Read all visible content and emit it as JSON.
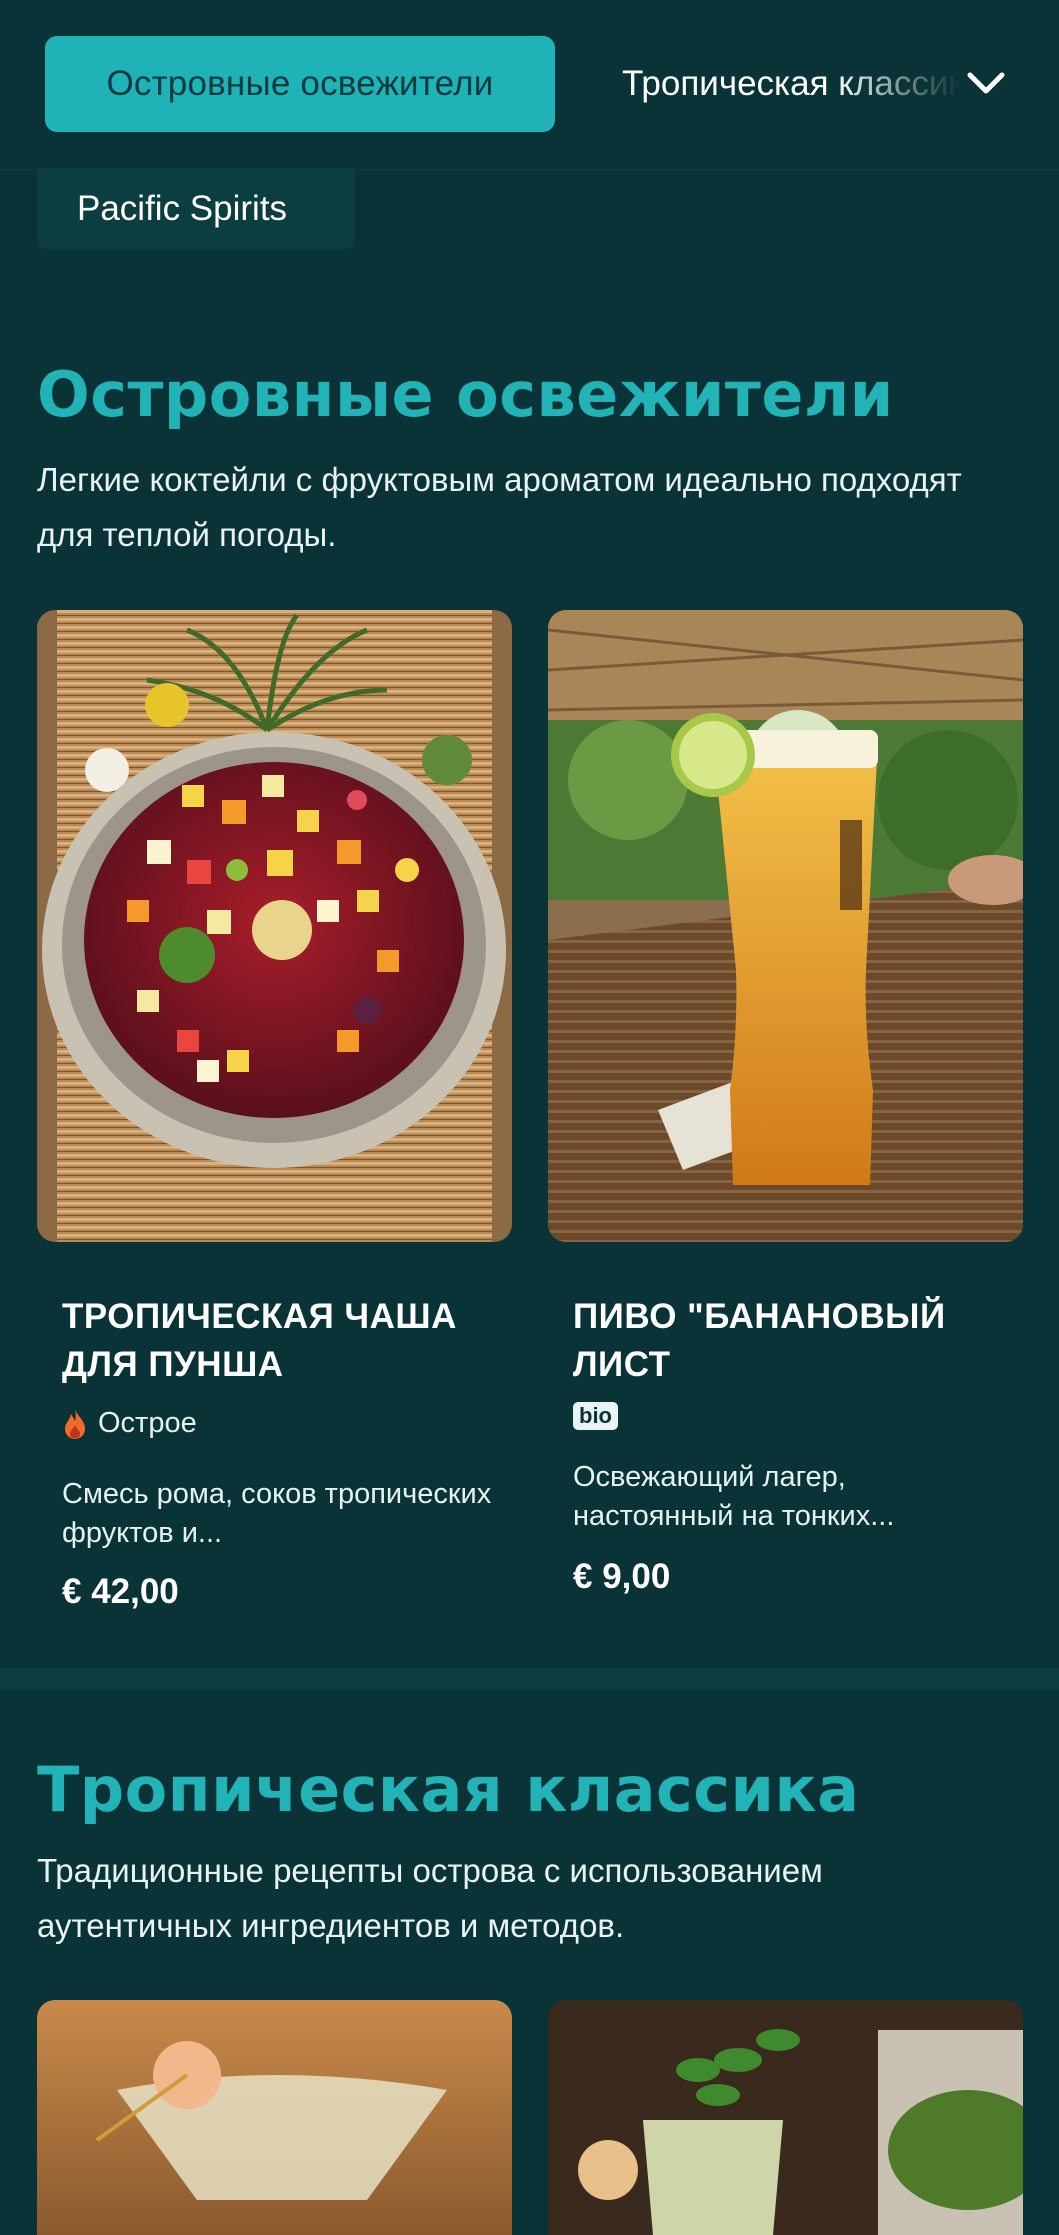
{
  "nav": {
    "active_tab": "Островные освежители",
    "next_tab": "Тропическая классика",
    "sub_tab": "Pacific Spirits"
  },
  "sections": [
    {
      "title": "Островные освежители",
      "description": "Легкие коктейли с фруктовым ароматом идеально подходят для теплой погоды.",
      "items": [
        {
          "name": "ТРОПИЧЕСКАЯ ЧАША ДЛЯ ПУНША",
          "tag": "Острое",
          "tag_icon": "fire-icon",
          "description": "Смесь рома, соков тропических фруктов и...",
          "price": "€ 42,00"
        },
        {
          "name": "ПИВО \"БАНАНОВЫЙ ЛИСТ",
          "tag": "bio",
          "description": "Освежающий лагер, настоянный на тонких...",
          "price": "€ 9,00"
        }
      ]
    },
    {
      "title": "Тропическая классика",
      "description": "Традиционные рецепты острова с использованием аутентичных ингредиентов и методов."
    }
  ],
  "colors": {
    "background": "#093337",
    "accent": "#1fb3b8",
    "title": "#21b3b5",
    "spicy": "#f26a2a"
  }
}
